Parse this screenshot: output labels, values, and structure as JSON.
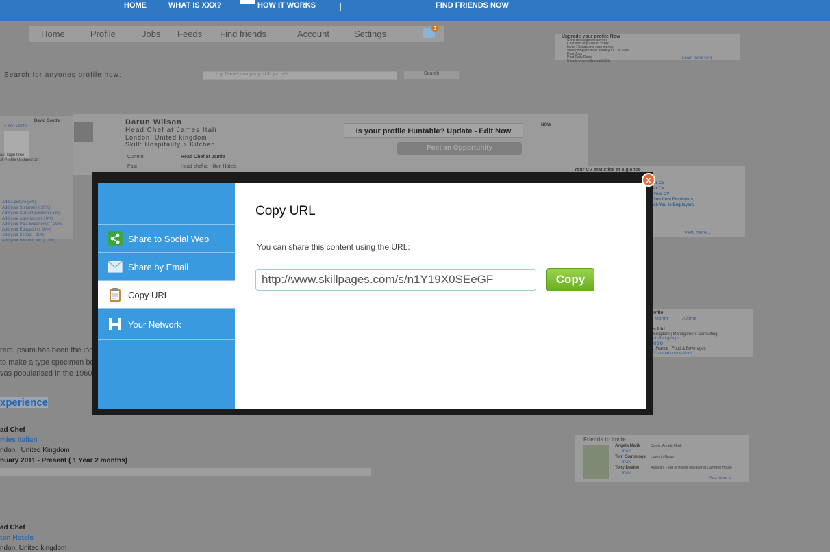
{
  "topnav": {
    "home": "HOME",
    "what_is": "WHAT IS XXX?",
    "how_it_works": "HOW IT WORKS",
    "find_friends": "FIND FRIENDS NOW"
  },
  "subnav": {
    "items": [
      "Home",
      "Profile",
      "Jobs",
      "Feeds",
      "Find friends",
      "Account",
      "Settings"
    ],
    "mail_badge": "3"
  },
  "search": {
    "label": "Search for anyones profile now:",
    "placeholder": "e.g. Name, company, skill, job title",
    "button": "Search"
  },
  "left_card": {
    "name": "David Coutts",
    "add_photo": "+ Add Photo",
    "last_login": "ast login time:",
    "profile_updated": "st Profile Updated on:",
    "completion_items": [
      "Add a picture (5%)",
      "Add your Summary ( 20%)",
      "Add your Current position ( 5%)",
      "Add your experience ( 10%)",
      "Add your Past Experience ( 20%)",
      "Add your Education ( 20%)",
      "Add your School ( 10%)",
      "Add your Interest, etc..( 10%)"
    ]
  },
  "profile": {
    "name": "Darun Wilson",
    "headline": "Head Chef at James Itali",
    "location": "London, United kingdom",
    "skill": "Skill: Hospitality > Kitchen",
    "huntable_btn": "Is your profile Huntable? Update - Edit Now",
    "post_btn": "Post an Opportunity",
    "now_label": "NOW",
    "current_label": "Current",
    "current_value": "Head Chef at Jamie",
    "past_label": "Past",
    "past_value": "Head chef at Hilton Hotels"
  },
  "upgrade": {
    "title": "Upgrade your profile Now",
    "items": [
      "Send messages to anyone",
      "Chat with any user of xxxxx",
      "Invite Friends and earn money",
      "View complete stats about your CV View",
      "Post Jobs",
      "Post Daily Deals",
      "Update your daily availability"
    ],
    "link": "Learn more here"
  },
  "stats": {
    "title": "Your CV statistics at a glance",
    "lines": [
      "ur CV",
      "ur CV",
      "Your CV",
      "You from Employers",
      "ch You to Employers"
    ],
    "view_more": "view more..."
  },
  "visitors": {
    "title": "ofile",
    "tabs": [
      "Month",
      "Alltime"
    ],
    "lines": [
      "s Ltd",
      "Kingdom | Management Consulting",
      "shared groups",
      "edo",
      ", France | Food & Beverages",
      "3 shared connections"
    ]
  },
  "summary": {
    "lines": [
      "rem Ipsum has been the ind",
      "to make a type specimen bo",
      "vas popularised in the 1960"
    ]
  },
  "experience": {
    "heading": "xperience",
    "job1_title": "ad Chef",
    "job1_company": "mies Italian",
    "job1_location": "ndon , United Kingdom",
    "job1_dates": "nuary 2011 - Present ( 1 Year 2 months)",
    "job2_title": "ad Chef",
    "job2_company": "ton Hotels",
    "job2_location": "ndon, United kingdom"
  },
  "friends": {
    "title": "Friends to Invite",
    "people": [
      {
        "name": "Angela Malik",
        "role": "Owner, Angela Malik",
        "action": "Invite"
      },
      {
        "name": "Tom Cummings",
        "role": "Lipworth Group",
        "action": "Invite"
      },
      {
        "name": "Tony Devine",
        "role": "Assistant Food of House Manager at Cameron House",
        "action": "Invite"
      }
    ],
    "see_more": "See more »"
  },
  "modal": {
    "title": "Copy URL",
    "description": "You can share this content using the URL:",
    "url": "http://www.skillpages.com/s/n1Y19X0SEeGF",
    "copy_button": "Copy",
    "close": "x",
    "menu": [
      {
        "label": "Share to Social Web",
        "icon": "share-icon"
      },
      {
        "label": "Share by Email",
        "icon": "envelope-icon"
      },
      {
        "label": "Copy URL",
        "icon": "clipboard-icon"
      },
      {
        "label": "Your Network",
        "icon": "network-h-icon"
      }
    ]
  },
  "colors": {
    "topbar": "#2f78c4",
    "modal_sidebar": "#3a9ae0",
    "copy_button": "#7dbf31",
    "close_button": "#ea6a3c",
    "overlay": "#8a8a8a"
  }
}
